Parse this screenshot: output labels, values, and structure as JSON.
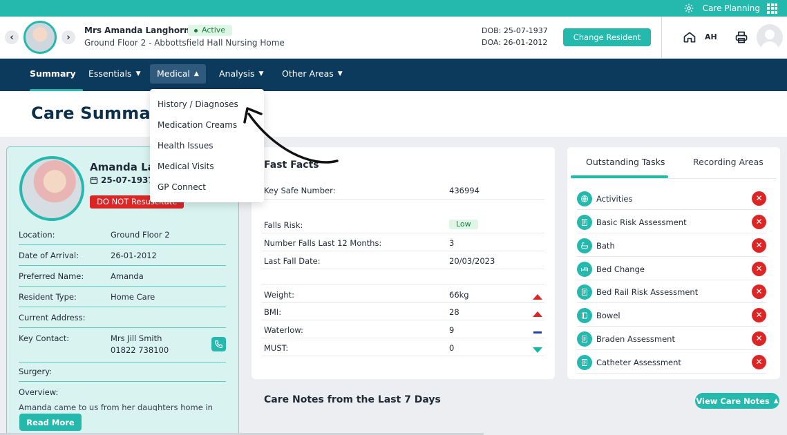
{
  "topbar": {
    "label": "Care Planning"
  },
  "resident": {
    "name": "Mrs Amanda Langhorn",
    "status": "Active",
    "location": "Ground Floor 2 - Abbottsfield Hall Nursing Home",
    "dob": "DOB: 25-07-1937",
    "doa": "DOA: 26-01-2012",
    "change_label": "Change Resident",
    "initials": "AH"
  },
  "nav": {
    "summary": "Summary",
    "essentials": "Essentials",
    "medical": "Medical",
    "analysis": "Analysis",
    "other": "Other Areas"
  },
  "dropdown": {
    "items": [
      "History / Diagnoses",
      "Medication Creams",
      "Health Issues",
      "Medical Visits",
      "GP Connect"
    ]
  },
  "page": {
    "title": "Care Summar"
  },
  "card": {
    "name": "Amanda La",
    "dob": "25-07-1937",
    "dnr": "DO NOT Resuscitate",
    "details": [
      {
        "key": "Location:",
        "value": "Ground Floor 2"
      },
      {
        "key": "Date of Arrival:",
        "value": "26-01-2012"
      },
      {
        "key": "Preferred Name:",
        "value": "Amanda"
      },
      {
        "key": "Resident Type:",
        "value": "Home Care"
      },
      {
        "key": "Current Address:",
        "value": ""
      }
    ],
    "key_contact_label": "Key Contact:",
    "key_contact_name": "Mrs Jill Smith",
    "key_contact_phone": "01822 738100",
    "surgery_label": "Surgery:",
    "overview_label": "Overview:",
    "overview_text": "Amanda came to us from her daughters home in",
    "read_more": "Read More"
  },
  "fast_facts": {
    "title": "Fast Facts",
    "key_safe_label": "Key Safe Number:",
    "key_safe_value": "436994",
    "falls_risk_label": "Falls Risk:",
    "falls_risk_value": "Low",
    "falls_12_label": "Number Falls Last 12 Months:",
    "falls_12_value": "3",
    "last_fall_label": "Last Fall Date:",
    "last_fall_value": "20/03/2023",
    "measures": [
      {
        "key": "Weight:",
        "value": "66kg",
        "trend": "up"
      },
      {
        "key": "BMI:",
        "value": "28",
        "trend": "up"
      },
      {
        "key": "Waterlow:",
        "value": "9",
        "trend": "flat"
      },
      {
        "key": "MUST:",
        "value": "0",
        "trend": "down"
      }
    ],
    "colors": {
      "up": "#dc2626",
      "flat": "#1e40af",
      "down": "#10b9a3"
    }
  },
  "tasks": {
    "tab_active": "Outstanding Tasks",
    "tab_inactive": "Recording Areas",
    "items": [
      {
        "label": "Activities",
        "icon": "activities-icon"
      },
      {
        "label": "Basic Risk Assessment",
        "icon": "assessment-icon"
      },
      {
        "label": "Bath",
        "icon": "bath-icon"
      },
      {
        "label": "Bed Change",
        "icon": "bed-icon"
      },
      {
        "label": "Bed Rail Risk Assessment",
        "icon": "assessment-icon"
      },
      {
        "label": "Bowel",
        "icon": "bowel-icon"
      },
      {
        "label": "Braden Assessment",
        "icon": "assessment-icon"
      },
      {
        "label": "Catheter Assessment",
        "icon": "assessment-icon"
      }
    ]
  },
  "notes": {
    "title": "Care Notes from the Last 7 Days",
    "view_label": "View Care Notes"
  }
}
